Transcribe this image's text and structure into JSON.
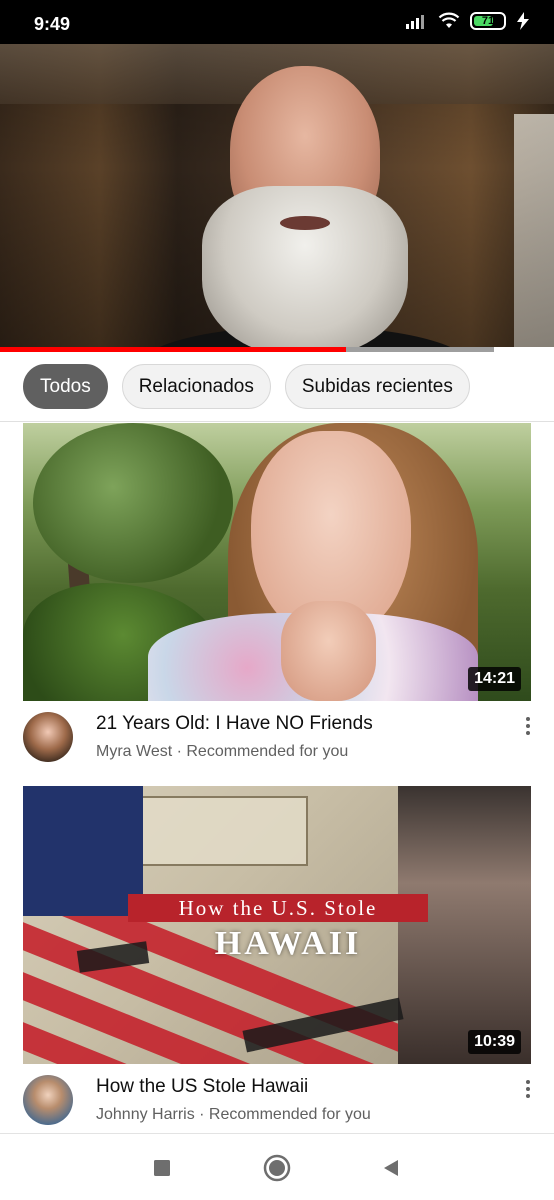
{
  "status_bar": {
    "time": "9:49",
    "battery_percent": 71,
    "battery_label": "71",
    "icons": [
      "signal-icon",
      "wifi-icon",
      "battery-icon",
      "charging-icon"
    ]
  },
  "player": {
    "progress_fraction": 0.7,
    "colors": {
      "played": "#ff0000",
      "buffered": "#9e9e9e"
    }
  },
  "chips": [
    {
      "label": "Todos",
      "selected": true
    },
    {
      "label": "Relacionados",
      "selected": false
    },
    {
      "label": "Subidas recientes",
      "selected": false
    }
  ],
  "videos": [
    {
      "title": "21 Years Old: I Have NO Friends",
      "channel_line": "Myra West · Recommended for you",
      "duration": "14:21"
    },
    {
      "title": "How the US Stole Hawaii",
      "channel_line": "Johnny Harris · Recommended for you",
      "duration": "10:39",
      "thumb_text_line1": "How the U.S. Stole",
      "thumb_text_line2": "HAWAII"
    }
  ],
  "nav_bar": {
    "buttons": [
      "recents-square-icon",
      "home-circle-icon",
      "back-triangle-icon"
    ]
  }
}
